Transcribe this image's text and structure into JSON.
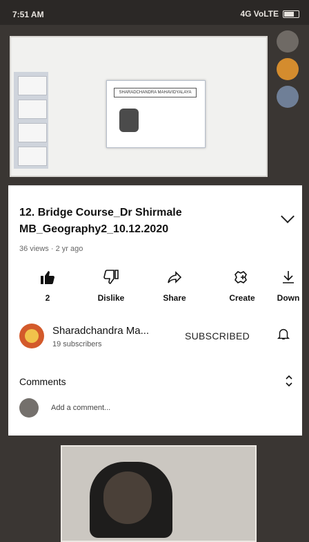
{
  "status_bar": {
    "time": "7:51 AM",
    "network": "4G VoLTE"
  },
  "video": {
    "slide_title": "SHARADCHANDRA MAHAVIDYALAYA"
  },
  "details": {
    "title": "12. Bridge Course_Dr Shirmale MB_Geography2_10.12.2020",
    "meta": "36 views · 2 yr ago"
  },
  "actions": [
    {
      "label": "2",
      "icon": "thumbs-up-icon"
    },
    {
      "label": "Dislike",
      "icon": "thumbs-down-icon"
    },
    {
      "label": "Share",
      "icon": "share-icon"
    },
    {
      "label": "Create",
      "icon": "create-icon"
    },
    {
      "label": "Down",
      "icon": "download-icon"
    }
  ],
  "channel": {
    "name": "Sharadchandra Ma...",
    "subscribers": "19 subscribers",
    "subscribed_label": "SUBSCRIBED"
  },
  "comments": {
    "label": "Comments",
    "add_placeholder": "Add a comment..."
  },
  "colors": {
    "accent": "#ff3b30",
    "sheet_bg": "#ffffff",
    "background": "#3a3633"
  }
}
